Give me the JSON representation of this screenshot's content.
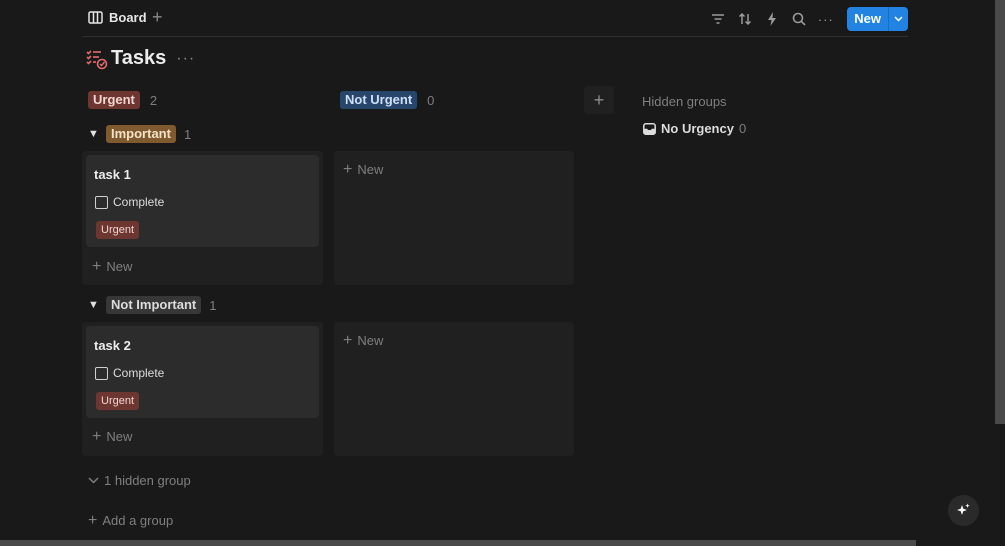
{
  "view": {
    "tab_label": "Board",
    "add_view": "+"
  },
  "toolbar": {
    "new_label": "New",
    "more": "···"
  },
  "page": {
    "title": "Tasks",
    "more": "···"
  },
  "columns": [
    {
      "label": "Urgent",
      "count": "2",
      "color": "#6e3630"
    },
    {
      "label": "Not Urgent",
      "count": "0",
      "color": "#28456c"
    }
  ],
  "add_column": "+",
  "hidden_groups": {
    "title": "Hidden groups",
    "items": [
      {
        "label": "No Urgency",
        "count": "0"
      }
    ]
  },
  "groups": [
    {
      "label": "Important",
      "count": "1",
      "color": "#7f5a2e",
      "card": {
        "title": "task 1",
        "checkbox_label": "Complete",
        "tag": "Urgent"
      }
    },
    {
      "label": "Not Important",
      "count": "1",
      "color": "#373737",
      "card": {
        "title": "task 2",
        "checkbox_label": "Complete",
        "tag": "Urgent"
      }
    }
  ],
  "new_label": "New",
  "footer": {
    "hidden_group_toggle": "1 hidden group",
    "add_group": "Add a group"
  }
}
